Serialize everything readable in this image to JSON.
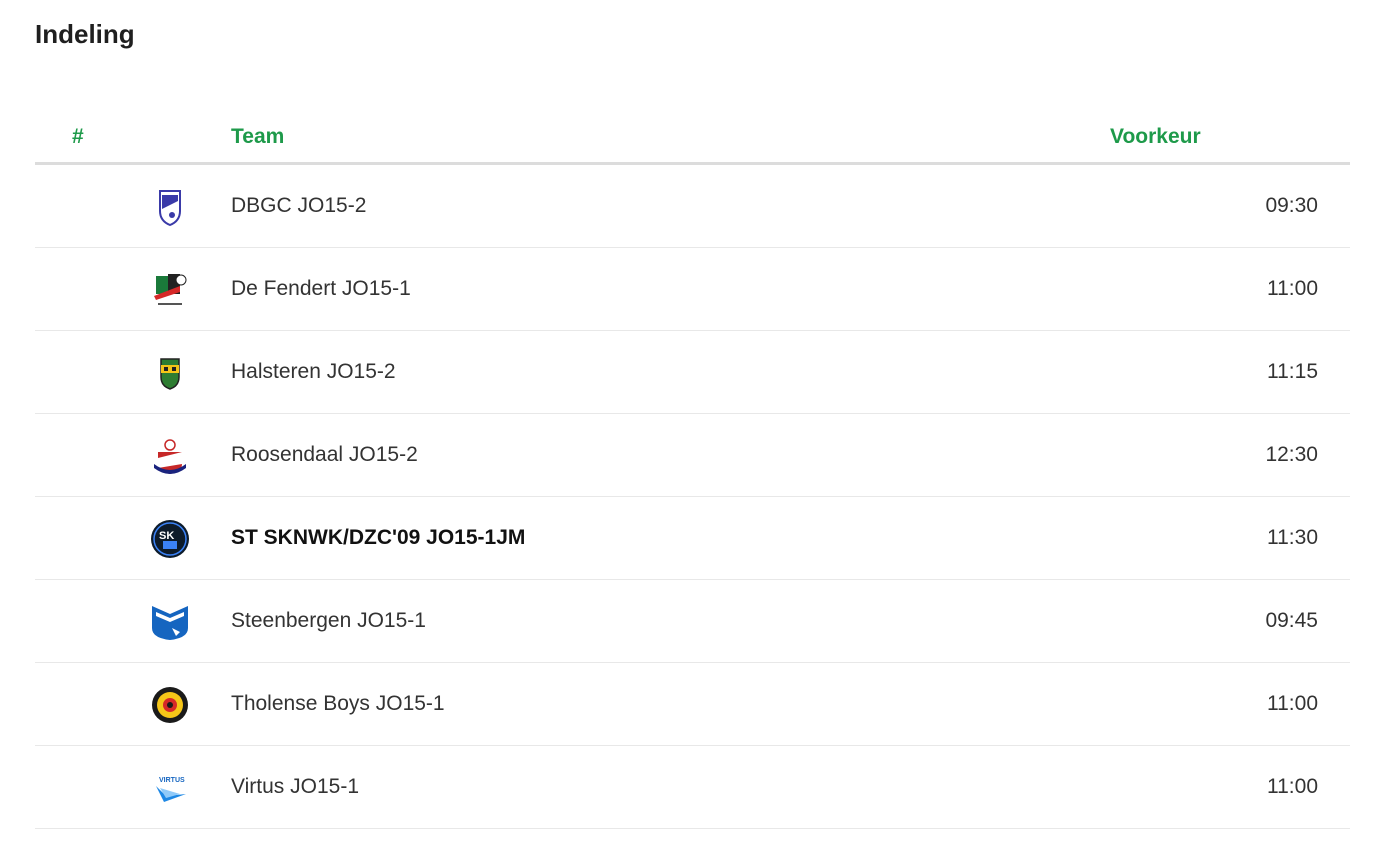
{
  "page": {
    "title": "Indeling"
  },
  "colors": {
    "accent": "#1e9a4a",
    "text": "#333333",
    "divider": "#e8e8e8"
  },
  "table": {
    "headers": {
      "number": "#",
      "team": "Team",
      "preference": "Voorkeur"
    },
    "rows": [
      {
        "logo": "dbgc-logo-icon",
        "team": "DBGC JO15-2",
        "time": "09:30",
        "highlight": false
      },
      {
        "logo": "de-fendert-logo-icon",
        "team": "De Fendert JO15-1",
        "time": "11:00",
        "highlight": false
      },
      {
        "logo": "halsteren-logo-icon",
        "team": "Halsteren JO15-2",
        "time": "11:15",
        "highlight": false
      },
      {
        "logo": "roosendaal-logo-icon",
        "team": "Roosendaal JO15-2",
        "time": "12:30",
        "highlight": false
      },
      {
        "logo": "sknwk-logo-icon",
        "team": "ST SKNWK/DZC'09 JO15-1JM",
        "time": "11:30",
        "highlight": true
      },
      {
        "logo": "steenbergen-logo-icon",
        "team": "Steenbergen JO15-1",
        "time": "09:45",
        "highlight": false
      },
      {
        "logo": "tholense-boys-logo-icon",
        "team": "Tholense Boys JO15-1",
        "time": "11:00",
        "highlight": false
      },
      {
        "logo": "virtus-logo-icon",
        "team": "Virtus JO15-1",
        "time": "11:00",
        "highlight": false
      }
    ]
  }
}
